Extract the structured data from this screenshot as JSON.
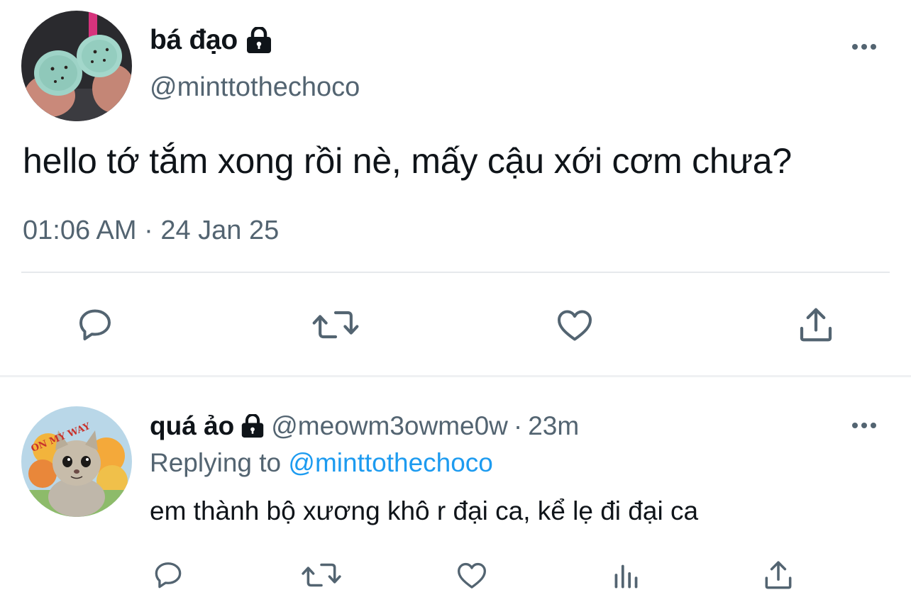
{
  "main_tweet": {
    "display_name": "bá đạo",
    "handle": "@minttothechoco",
    "text": "hello tớ tắm xong rồi nè, mấy cậu xới cơm chưa?",
    "meta": "01:06 AM · 24 Jan 25",
    "icons": [
      "lock-icon",
      "more-icon",
      "reply-icon",
      "retweet-icon",
      "like-icon",
      "share-icon"
    ]
  },
  "reply_tweet": {
    "display_name": "quá ảo",
    "handle": "@meowm3owme0w",
    "separator": "·",
    "time": "23m",
    "replying_label": "Replying to",
    "replying_to": "@minttothechoco",
    "text": "em thành bộ xương khô r đại ca, kể lẹ đi đại ca",
    "avatar_caption": "ON MY WAY",
    "icons": [
      "lock-icon",
      "more-icon",
      "reply-icon",
      "retweet-icon",
      "like-icon",
      "stats-icon",
      "share-icon"
    ]
  },
  "colors": {
    "text": "#0f1419",
    "secondary": "#536471",
    "link": "#1d9bf0",
    "divider": "#e6e9ec"
  }
}
